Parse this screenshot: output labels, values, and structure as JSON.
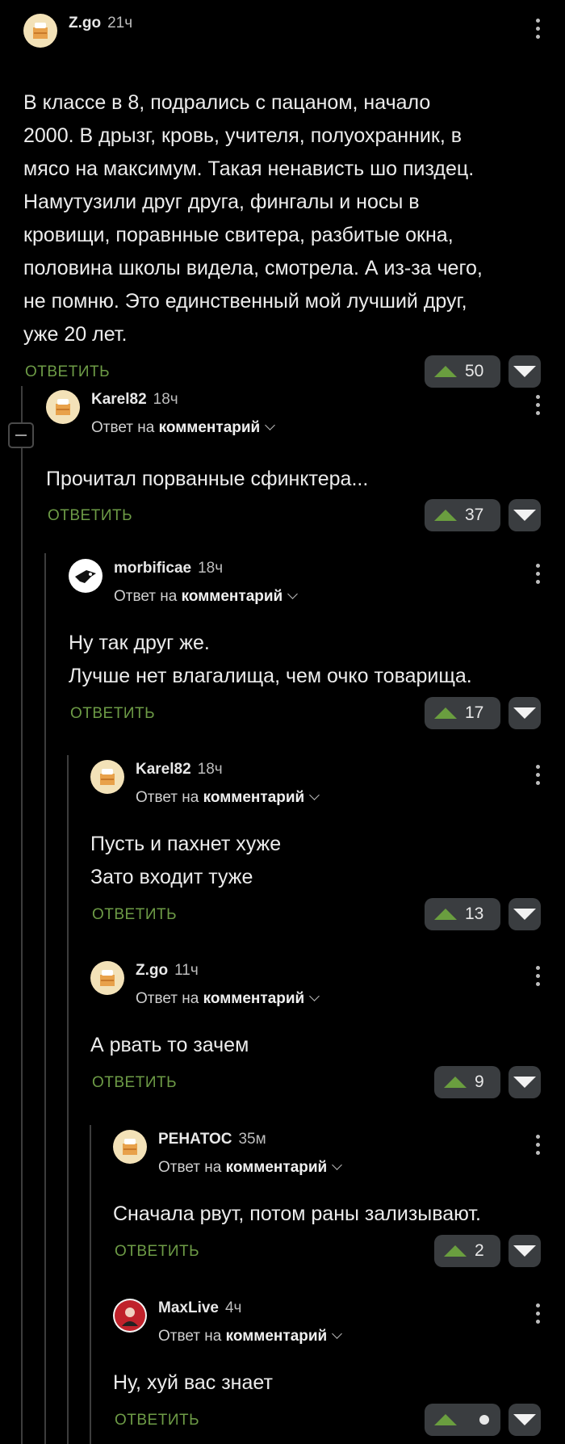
{
  "reply_label": "ОТВЕТИТЬ",
  "reply_to_prefix": "Ответ на",
  "reply_to_target": "комментарий",
  "colors": {
    "background": "#000000",
    "reply": "#6d9b46",
    "upvote": "#6a9e3f",
    "vote_bg": "#3a3d40"
  },
  "comments": [
    {
      "author": "Z.go",
      "time": "21ч",
      "lines": [
        "В классе в 8, подрались с пацаном, начало",
        "2000. В дрызг, кровь, учителя, полуохранник, в",
        "мясо на максимум. Такая ненависть шо пиздец.",
        "Намутузили друг друга, фингалы и носы в",
        "кровищи, поравнные свитера, разбитые окна,",
        "половина школы видела, смотрела. А из-за чего,",
        "не помню. Это единственный мой лучший друг,",
        "уже 20 лет."
      ],
      "votes": "50"
    },
    {
      "author": "Karel82",
      "time": "18ч",
      "lines": [
        "Прочитал порванные сфинктера..."
      ],
      "votes": "37"
    },
    {
      "author": "morbificae",
      "time": "18ч",
      "lines": [
        "Ну так друг же.",
        "Лучше нет влагалища, чем очко товарища."
      ],
      "votes": "17"
    },
    {
      "author": "Karel82",
      "time": "18ч",
      "lines": [
        "Пусть и пахнет хуже",
        "Зато входит туже"
      ],
      "votes": "13"
    },
    {
      "author": "Z.go",
      "time": "11ч",
      "lines": [
        "А рвать то зачем"
      ],
      "votes": "9"
    },
    {
      "author": "РЕНАТОС",
      "time": "35м",
      "lines": [
        "Сначала рвут, потом раны зализывают."
      ],
      "votes": "2"
    },
    {
      "author": "MaxLive",
      "time": "4ч",
      "lines": [
        "Ну, хуй вас знает"
      ],
      "votes": ""
    }
  ]
}
